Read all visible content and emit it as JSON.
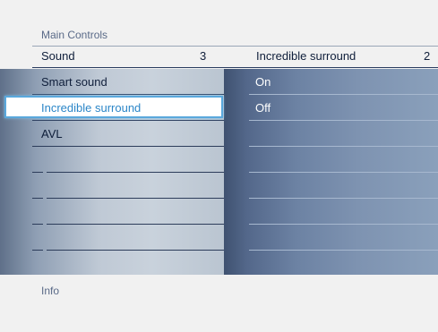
{
  "header": {
    "title": "Main Controls",
    "left_item": "Sound",
    "left_count": "3",
    "right_item": "Incredible surround",
    "right_count": "2"
  },
  "left_menu": {
    "items": [
      {
        "label": "Smart sound"
      },
      {
        "label": "Incredible surround",
        "selected": true
      },
      {
        "label": "AVL"
      }
    ],
    "empty_rows": 5
  },
  "right_menu": {
    "options": [
      {
        "label": "On"
      },
      {
        "label": "Off"
      }
    ],
    "empty_rows": 6
  },
  "footer": {
    "info": "Info"
  },
  "colors": {
    "highlight_border": "#5aa8dc",
    "highlight_text": "#2b86c8",
    "label_text": "#0f1e3a",
    "caption_text": "#5a6a88"
  }
}
